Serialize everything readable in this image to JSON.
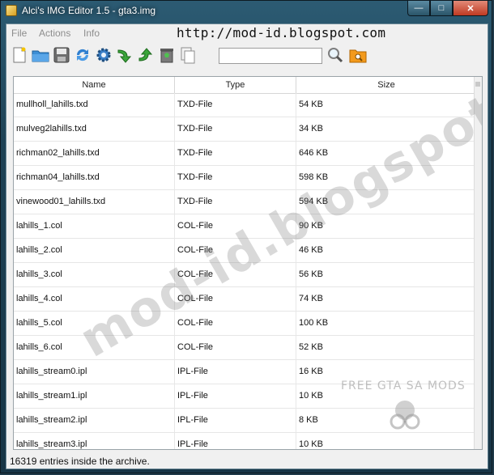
{
  "window": {
    "title": "Alci's IMG Editor 1.5 - gta3.img",
    "min_glyph": "—",
    "max_glyph": "□",
    "close_glyph": "✕"
  },
  "menu": {
    "items": [
      "File",
      "Actions",
      "Info"
    ]
  },
  "watermark": {
    "top_url": "http://mod-id.blogspot.com",
    "diagonal": "mod-id.blogspot.com",
    "badge": "FREE GTA SA MODS"
  },
  "toolbar": {
    "search_value": "",
    "icons": [
      "new-file-icon",
      "open-folder-icon",
      "save-icon",
      "refresh-icon",
      "settings-gear-icon",
      "arrow-down-icon",
      "arrow-up-icon",
      "recycle-bin-icon",
      "copy-icon",
      "search-icon",
      "folder-search-icon"
    ]
  },
  "table": {
    "columns": [
      "Name",
      "Type",
      "Size"
    ],
    "rows": [
      [
        "mullholl_lahills.txd",
        "TXD-File",
        "54 KB"
      ],
      [
        "mulveg2lahills.txd",
        "TXD-File",
        "34 KB"
      ],
      [
        "richman02_lahills.txd",
        "TXD-File",
        "646 KB"
      ],
      [
        "richman04_lahills.txd",
        "TXD-File",
        "598 KB"
      ],
      [
        "vinewood01_lahills.txd",
        "TXD-File",
        "594 KB"
      ],
      [
        "lahills_1.col",
        "COL-File",
        "90 KB"
      ],
      [
        "lahills_2.col",
        "COL-File",
        "46 KB"
      ],
      [
        "lahills_3.col",
        "COL-File",
        "56 KB"
      ],
      [
        "lahills_4.col",
        "COL-File",
        "74 KB"
      ],
      [
        "lahills_5.col",
        "COL-File",
        "100 KB"
      ],
      [
        "lahills_6.col",
        "COL-File",
        "52 KB"
      ],
      [
        "lahills_stream0.ipl",
        "IPL-File",
        "16 KB"
      ],
      [
        "lahills_stream1.ipl",
        "IPL-File",
        "10 KB"
      ],
      [
        "lahills_stream2.ipl",
        "IPL-File",
        "8 KB"
      ],
      [
        "lahills_stream3.ipl",
        "IPL-File",
        "10 KB"
      ]
    ]
  },
  "status": {
    "text": "16319 entries inside the archive."
  }
}
